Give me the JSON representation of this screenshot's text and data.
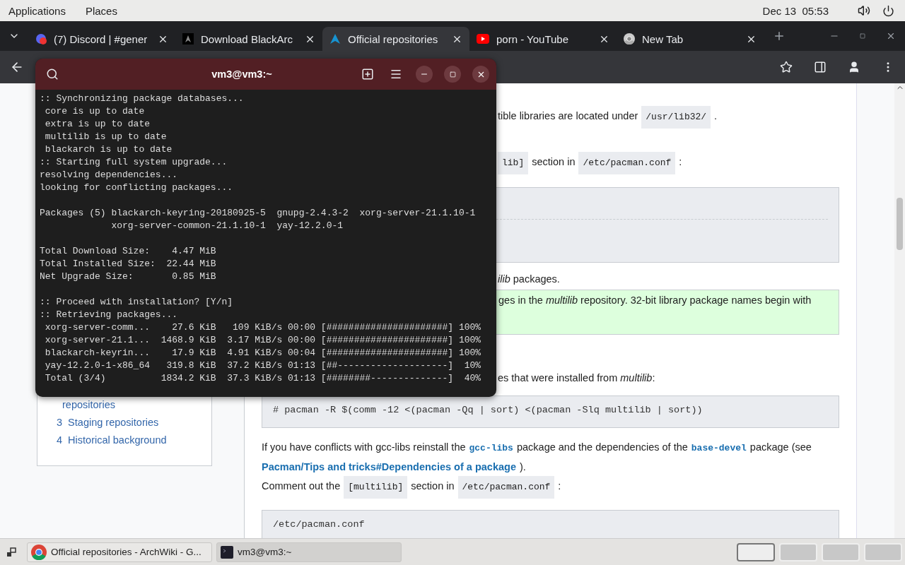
{
  "top_bar": {
    "menus": [
      "Applications",
      "Places"
    ],
    "clock": "Dec 13  05:53"
  },
  "browser": {
    "tabs": [
      {
        "title": "(7) Discord | #gener",
        "selected": false
      },
      {
        "title": "Download BlackArc",
        "selected": false
      },
      {
        "title": "Official repositories",
        "selected": true
      },
      {
        "title": "porn - YouTube",
        "selected": false
      },
      {
        "title": "New Tab",
        "selected": false
      }
    ],
    "toc": [
      {
        "text": "repositories"
      },
      {
        "number": "3",
        "text": "Staging repositories"
      },
      {
        "number": "4",
        "text": "Historical background"
      }
    ],
    "content": [
      {
        "kind": "fragment",
        "parts": [
          {
            "kind": "text",
            "text": "tible libraries are located under"
          },
          {
            "kind": "code",
            "text": "/usr/lib32/"
          },
          {
            "kind": "text",
            "text": "."
          }
        ]
      },
      {
        "kind": "fragment",
        "parts": [
          {
            "kind": "code",
            "text": "lib]"
          },
          {
            "kind": "text",
            "text": "section in"
          },
          {
            "kind": "code",
            "text": "/etc/pacman.conf"
          },
          {
            "kind": "text",
            "text": ":"
          }
        ]
      },
      {
        "kind": "empty-code"
      },
      {
        "kind": "fragment",
        "parts": [
          {
            "kind": "text",
            "text": "*ilib* packages."
          }
        ]
      },
      {
        "kind": "note",
        "text": "ges in the *multilib* repository. 32-bit library package names begin with"
      },
      {
        "kind": "fragment",
        "parts": [
          {
            "kind": "text",
            "text": "es that were installed from *multilib*:"
          }
        ]
      },
      {
        "kind": "code",
        "text": "# pacman -R $(comm -12 <(pacman -Qq | sort) <(pacman -Slq multilib | sort))"
      },
      {
        "kind": "para",
        "parts": [
          {
            "kind": "text",
            "text": "If you have conflicts with gcc-libs reinstall the"
          },
          {
            "kind": "codelink",
            "text": "gcc-libs"
          },
          {
            "kind": "text",
            "text": "package and the dependencies of the"
          },
          {
            "kind": "codelink",
            "text": "base-devel"
          },
          {
            "kind": "text",
            "text": "package (see"
          },
          {
            "kind": "link",
            "text": "Pacman/Tips and tricks#Dependencies of a package"
          },
          {
            "kind": "text",
            "text": ")."
          }
        ]
      },
      {
        "kind": "para",
        "parts": [
          {
            "kind": "text",
            "text": "Comment out the"
          },
          {
            "kind": "code",
            "text": "[multilib]"
          },
          {
            "kind": "text",
            "text": "section in"
          },
          {
            "kind": "code",
            "text": "/etc/pacman.conf"
          },
          {
            "kind": "text",
            "text": ":"
          }
        ]
      },
      {
        "kind": "file-header",
        "text": "/etc/pacman.conf"
      }
    ]
  },
  "terminal": {
    "title": "vm3@vm3:~",
    "blocks": [
      [
        ":: Synchronizing package databases...",
        " core is up to date",
        " extra is up to date",
        " multilib is up to date",
        " blackarch is up to date",
        ":: Starting full system upgrade...",
        "resolving dependencies...",
        "looking for conflicting packages..."
      ],
      [
        "Packages (5) blackarch-keyring-20180925-5  gnupg-2.4.3-2  xorg-server-21.1.10-1",
        "             xorg-server-common-21.1.10-1  yay-12.2.0-1"
      ],
      [
        "Total Download Size:    4.47 MiB",
        "Total Installed Size:  22.44 MiB",
        "Net Upgrade Size:       0.85 MiB"
      ],
      [
        ":: Proceed with installation? [Y/n]",
        ":: Retrieving packages...",
        " xorg-server-comm...    27.6 KiB   109 KiB/s 00:00 [######################] 100%",
        " xorg-server-21.1...  1468.9 KiB  3.17 MiB/s 00:00 [######################] 100%",
        " blackarch-keyrin...    17.9 KiB  4.91 KiB/s 00:04 [######################] 100%",
        " yay-12.2.0-1-x86_64   319.8 KiB  37.2 KiB/s 01:13 [##--------------------]  10%",
        " Total (3/4)          1834.2 KiB  37.3 KiB/s 01:13 [########--------------]  40%"
      ]
    ]
  },
  "taskbar": {
    "windows": [
      {
        "title": "Official repositories - ArchWiki - G...",
        "selected": false
      },
      {
        "title": "vm3@vm3:~",
        "selected": true
      }
    ],
    "workspaces": [
      {
        "selected": true
      },
      {
        "selected": false
      },
      {
        "selected": false
      },
      {
        "selected": false
      }
    ]
  }
}
